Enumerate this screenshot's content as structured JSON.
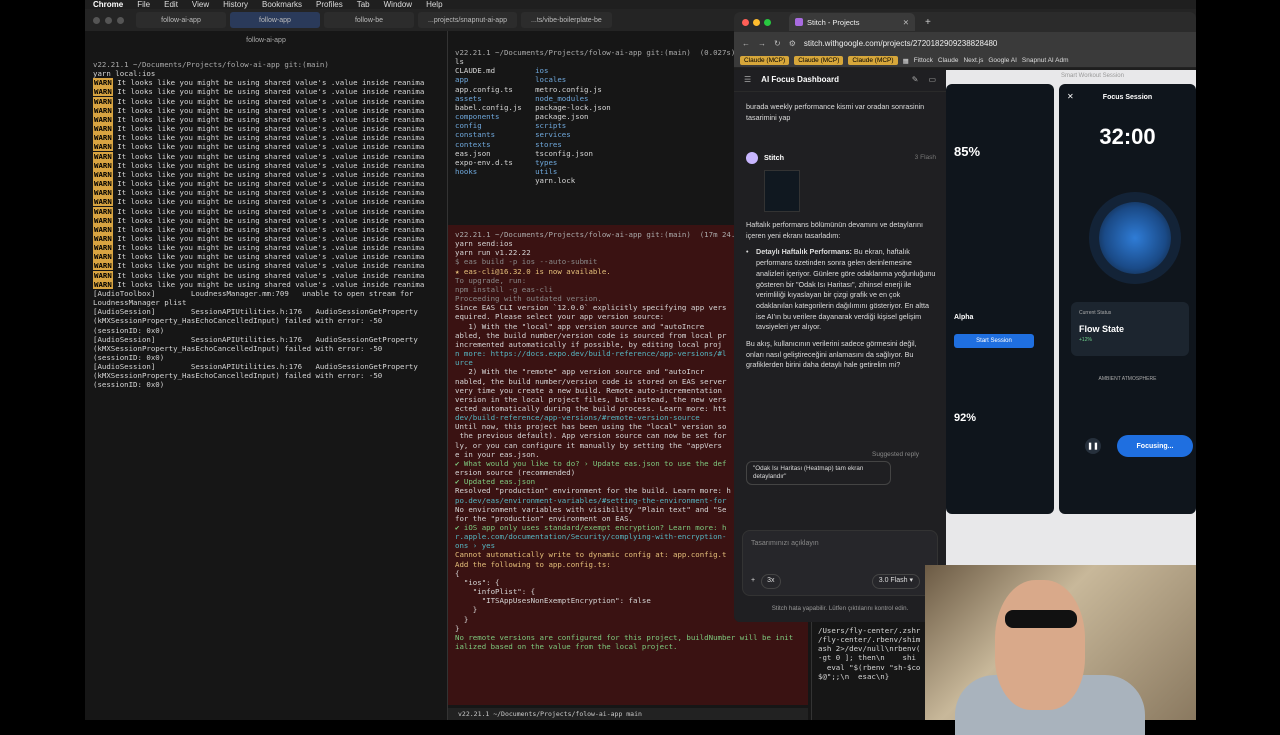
{
  "menubar": {
    "apple": "",
    "app": "Chrome",
    "items": [
      "File",
      "Edit",
      "View",
      "History",
      "Bookmarks",
      "Profiles",
      "Tab",
      "Window",
      "Help"
    ]
  },
  "terminal_tabs": [
    "follow-ai-app",
    "follow-app",
    "follow-be",
    "...projects/snapnut-ai-app",
    "...ts/vibe-boilerplate-be"
  ],
  "left_title": "follow-ai-app",
  "left_prompt": "v22.21.1 ~/Documents/Projects/folow-ai-app git:(main)",
  "left_cmd": "yarn local:ios",
  "warn_text": "WARN",
  "warn_msg": " It looks like you might be using shared value's .value inside reanima",
  "mid1_prompt": "v22.21.1 ~/Documents/Projects/folow-ai-app git:(main)  (0.027s)",
  "mid1_cmd": "ls",
  "ls_left": [
    "CLAUDE.md",
    "app",
    "app.config.ts",
    "assets",
    "babel.config.js",
    "components",
    "config",
    "constants",
    "contexts",
    "eas.json",
    "expo-env.d.ts",
    "hooks"
  ],
  "ls_right": [
    "ios",
    "locales",
    "metro.config.js",
    "node_modules",
    "package-lock.json",
    "package.json",
    "scripts",
    "services",
    "stores",
    "tsconfig.json",
    "types",
    "utils",
    "yarn.lock"
  ],
  "mid2_prompt": "v22.21.1 ~/Documents/Projects/folow-ai-app git:(main)  (17m 24.38s)",
  "mid2_cmd": "yarn send:ios",
  "mid2_lines": [
    "yarn run v1.22.22",
    "$ eas build -p ios --auto-submit",
    "★ eas-cli@16.32.0 is now available.",
    "To upgrade, run:",
    "npm install -g eas-cli",
    "Proceeding with outdated version.",
    "",
    "Since EAS CLI version `12.0.0` explicitly specifying app vers",
    "equired. Please select your app version source:",
    "   1) With the \"local\" app version source and \"autoIncre",
    "abled, the build number/version code is sourced from local pr",
    "incremented automatically if possible, by editing local proj",
    "n more: https://docs.expo.dev/build-reference/app-versions/#l",
    "urce",
    "   2) With the \"remote\" app version source and \"autoIncr",
    "nabled, the build number/version code is stored on EAS server",
    "very time you create a new build. Remote auto-incrementation",
    "version in the local project files, but instead, the new vers",
    "ected automatically during the build process. Learn more: htt",
    "dev/build-reference/app-versions/#remote-version-source",
    "Until now, this project has been using the \"local\" version so",
    " the previous default). App version source can now be set for",
    "ly, or you can configure it manually by setting the \"appVers",
    "e in your eas.json.",
    "✔ What would you like to do? › Update eas.json to use the def",
    "ersion source (recommended)",
    "✔ Updated eas.json",
    "Resolved \"production\" environment for the build. Learn more: h",
    "po.dev/eas/environment-variables/#setting-the-environment-for",
    "No environment variables with visibility \"Plain text\" and \"Se",
    "for the \"production\" environment on EAS.",
    "",
    "✔ iOS app only uses standard/exempt encryption? Learn more: h",
    "r.apple.com/documentation/Security/complying-with-encryption-",
    "ons › yes",
    "",
    "Cannot automatically write to dynamic config at: app.config.t",
    "Add the following to app.config.ts:",
    "",
    "{",
    "  \"ios\": {",
    "    \"infoPlist\": {",
    "      \"ITSAppUsesNonExemptEncryption\": false",
    "    }",
    "  }",
    "}",
    "",
    "No remote versions are configured for this project, buildNumber will be init",
    "ialized based on the value from the local project."
  ],
  "status_bar": "v22.21.1  ~/Documents/Projects/folow-ai-app  main",
  "left_tail": [
    "[AudioToolbox]        LoudnessManager.mm:709   unable to open stream for",
    "LoudnessManager plist",
    "[AudioSession]        SessionAPIUtilities.h:176   AudioSessionGetProperty",
    "(kMXSessionProperty_HasEchoCancelledInput) failed with error: -50",
    "(sessionID: 0x0)",
    "[AudioSession]        SessionAPIUtilities.h:176   AudioSessionGetProperty",
    "(kMXSessionProperty_HasEchoCancelledInput) failed with error: -50",
    "(sessionID: 0x0)",
    "[AudioSession]        SessionAPIUtilities.h:176   AudioSessionGetProperty",
    "(kMXSessionProperty_HasEchoCancelledInput) failed with error: -50",
    "(sessionID: 0x0)"
  ],
  "chrome": {
    "tab_title": "Stitch - Projects",
    "url": "stitch.withgoogle.com/projects/2720182909238828480",
    "bookmarks": [
      "Claude (MCP)",
      "Claude (MCP)",
      "Claude (MCP)",
      "Fittock",
      "Claude",
      "Next.js",
      "Google AI",
      "Snapnut AI Adm"
    ]
  },
  "stitch": {
    "title": "AI Focus Dashboard",
    "user_msg": "burada weekly performance kismi var oradan sonrasinin tasarimini yap",
    "bot_name": "Stitch",
    "bot_tag": "3 Flash",
    "p1": "Haftalık performans bölümünün devamını ve detaylarını içeren yeni ekranı tasarladım:",
    "b_title": "Detaylı Haftalık Performans:",
    "b_text": " Bu ekran, haftalık performans özetinden sonra gelen derinlemesine analizleri içeriyor. Günlere göre odaklanma yoğunluğunu gösteren bir \"Odak Isı Haritası\", zihinsel enerji ile verimliliği kıyaslayan bir çizgi grafik ve en çok odaklanılan kategorilerin dağılımını gösteriyor. En altta ise AI'ın bu verilere dayanarak verdiği kişisel gelişim tavsiyeleri yer alıyor.",
    "p2": "Bu akış, kullanıcının verilerini sadece görmesini değil, onları nasıl geliştireceğini anlamasını da sağlıyor. Bu grafiklerden birini daha detaylı hale getirelim mi?",
    "sugg_label": "Suggested reply",
    "sugg": "\"Odak Isı Haritası (Heatmap) tam ekran detaylandır\"",
    "placeholder": "Tasarımınızı açıklayın",
    "multi": "3x",
    "model": "3.0 Flash",
    "disclaimer": "Stitch hata yapabilir. Lütfen çıktılarını kontrol edin."
  },
  "canvas": {
    "header": "Smart Workout Session",
    "p1_pct": "85%",
    "p1_alpha": "Alpha",
    "p1_start": "Start Session",
    "p1_92": "92%",
    "p2_title": "Focus Session",
    "p2_timer": "32:00",
    "p2_state_label": "Current Status",
    "p2_state": "Flow State",
    "p2_state_sub": "+12%",
    "p2_focusing": "Focusing...",
    "p2_ambient": "AMBIENT ATMOSPHERE"
  },
  "rterm": [
    "/Users/fly-center/.zshr",
    "/fly-center/.rbenv/shim",
    "ash 2>/dev/null\\nrbenv(",
    "-gt 0 ]; then\\n    shi",
    "  eval \"$(rbenv \"sh-$co",
    "$@\";;\\n  esac\\n}"
  ]
}
